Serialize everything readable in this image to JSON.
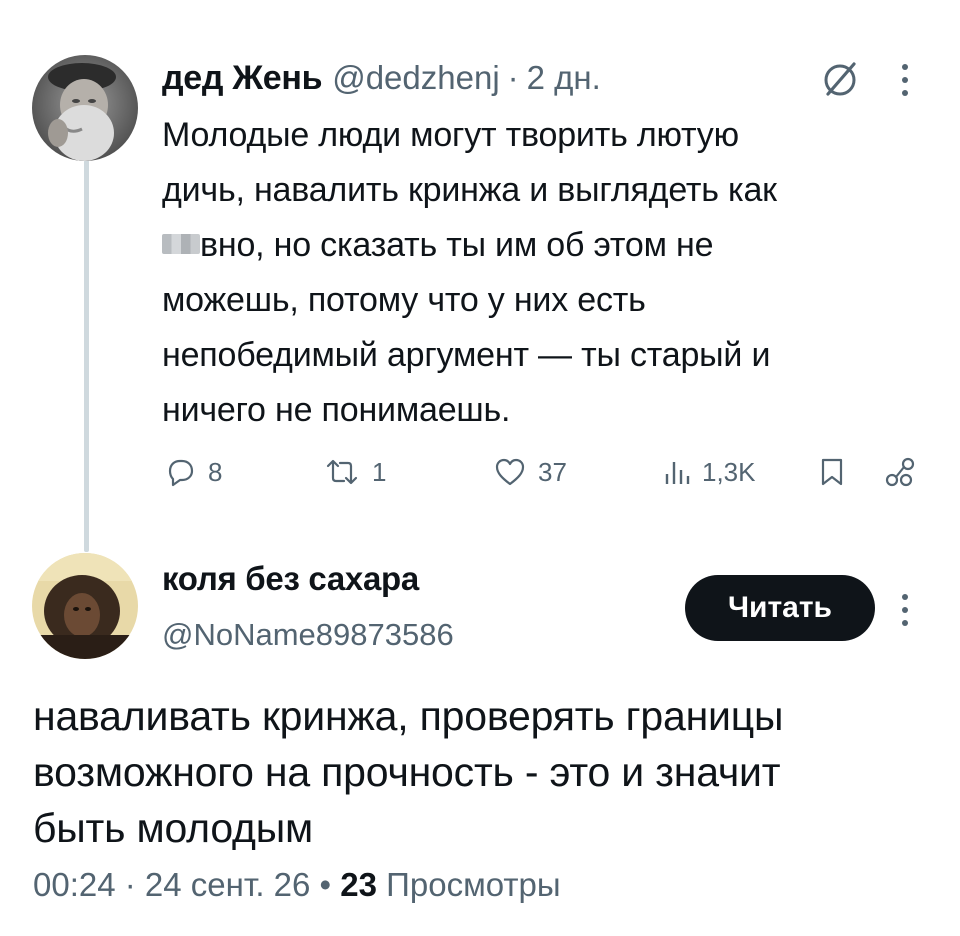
{
  "tweet1": {
    "author_name": "дед Жень",
    "handle": "@dedzhenj",
    "separator": "·",
    "time": "2 дн.",
    "text_lines": [
      "Молодые люди могут творить лютую",
      "дичь, навалить кринжа и выглядеть как",
      "вно, но сказать ты им об этом не",
      "можешь, потому что у них есть",
      "непобедимый аргумент — ты старый и",
      "ничего не понимаешь."
    ],
    "actions": {
      "replies": "8",
      "retweets": "1",
      "likes": "37",
      "views": "1,3K"
    }
  },
  "tweet2": {
    "author_name": "коля без сахара",
    "handle": "@NoName89873586",
    "follow_label": "Читать",
    "text_lines": [
      "наваливать кринжа, проверять границы",
      "возможного на прочность - это и значит",
      "быть молодым"
    ],
    "timestamp": "00:24 · 24 сент. 26",
    "meta_separator": "•",
    "views_count": "23",
    "views_label": "Просмотры"
  },
  "icons": {
    "reply": "reply-icon",
    "retweet": "retweet-icon",
    "like": "heart-icon",
    "views": "views-bar-icon",
    "bookmark": "bookmark-icon",
    "share": "share-icon",
    "grok": "grok-slash-icon",
    "more": "more-vertical-icon"
  },
  "colors": {
    "text": "#0f1419",
    "secondary": "#536471",
    "thread_line": "#cfd9de",
    "button_bg": "#0f1419"
  }
}
